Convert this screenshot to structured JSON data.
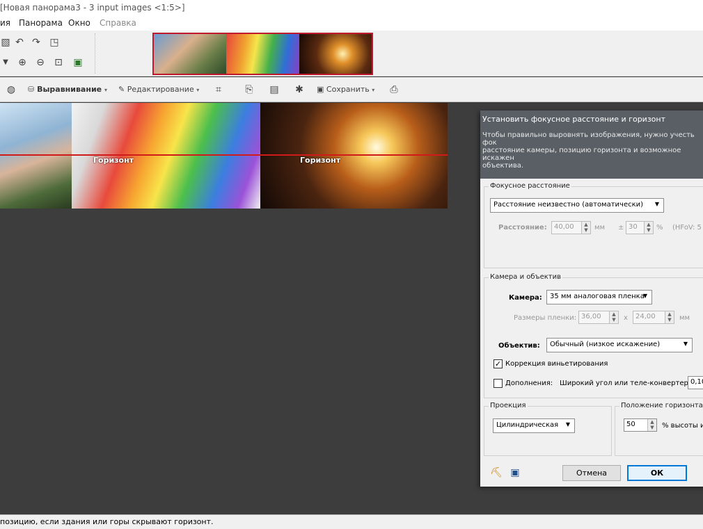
{
  "window": {
    "title": "[Новая панорама3 - 3 input images <1:5>]"
  },
  "menu": {
    "items": [
      "ия",
      "Панорама",
      "Окно",
      "Справка"
    ]
  },
  "toolbar2": {
    "align_label": "Выравнивание",
    "edit_label": "Редактирование",
    "save_label": "Сохранить"
  },
  "panorama": {
    "horizon_labels": [
      "Горизонт",
      "Горизонт"
    ],
    "horizon_percent": 50
  },
  "dialog": {
    "title": "Установить фокусное расстояние и горизонт",
    "description": "Чтобы правильно выровнять изображения, нужно учесть фок\nрасстояние камеры, позицию горизонта и возможное искажен\nобъектива.",
    "focal": {
      "group_title": "Фокусное расстояние",
      "mode_value": "Расстояние неизвестно (автоматически)",
      "distance_label": "Расстояние:",
      "distance_value": "40,00",
      "distance_unit": "мм",
      "plusminus": "±",
      "tolerance_value": "30",
      "tolerance_unit": "%",
      "hfov_text": "(HFoV: 5"
    },
    "camera": {
      "group_title": "Камера и объектив",
      "camera_label": "Камера:",
      "camera_value": "35 мм аналоговая пленка",
      "film_label": "Размеры пленки:",
      "film_width": "36,00",
      "film_x": "x",
      "film_height": "24,00",
      "film_unit": "мм",
      "lens_label": "Объектив:",
      "lens_value": "Обычный  (низкое искажение)",
      "vignetting_label": "Коррекция виньетирования",
      "vignetting_checked": true,
      "addon_label": "Дополнения:",
      "addon_text": "Широкий угол или теле-конвертер",
      "addon_value": "0,10",
      "addon_checked": false
    },
    "projection": {
      "group_title": "Проекция",
      "value": "Цилиндрическая"
    },
    "horizon": {
      "group_title": "Положение горизонта",
      "value": "50",
      "unit_text": "% высоты и"
    },
    "buttons": {
      "cancel": "Отмена",
      "ok": "ОК"
    }
  },
  "status": {
    "text": "позицию, если здания или горы скрывают горизонт."
  }
}
